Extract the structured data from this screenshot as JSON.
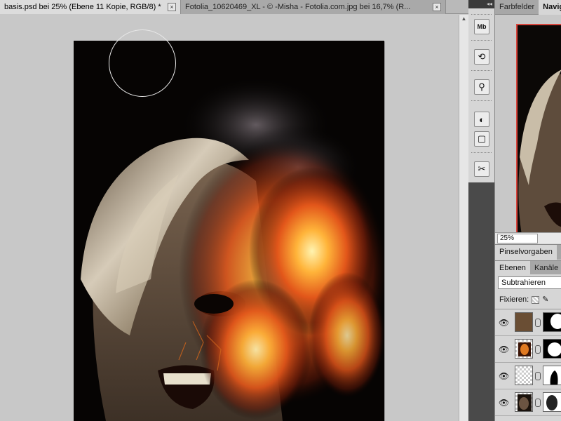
{
  "document_tabs": [
    {
      "label": "basis.psd bei 25% (Ebene 11 Kopie, RGB/8) *",
      "active": true,
      "close": "×"
    },
    {
      "label": "Fotolia_10620469_XL - © -Misha - Fotolia.com.jpg bei 16,7% (R...",
      "active": false,
      "close": "×"
    }
  ],
  "scrollbar": {
    "up_arrow": "▲"
  },
  "tool_strip": {
    "header": "◂◂",
    "tools": [
      {
        "name": "mini-bridge",
        "glyph": "Mb"
      },
      {
        "name": "history",
        "glyph": "⟲"
      },
      {
        "name": "clone-source",
        "glyph": "⚲"
      },
      {
        "name": "adjustments",
        "glyph": "◐"
      },
      {
        "name": "masks",
        "glyph": "▢"
      },
      {
        "name": "tool-presets",
        "glyph": "✂"
      }
    ]
  },
  "top_panel": {
    "tabs": [
      {
        "label": "Farbfelder",
        "active": false
      },
      {
        "label": "Navig",
        "active": true
      }
    ],
    "zoom_value": "25%"
  },
  "brush_panel": {
    "tabs": [
      {
        "label": "Pinselvorgaben",
        "active": true
      }
    ]
  },
  "layers_panel": {
    "tabs": [
      {
        "label": "Ebenen",
        "active": true
      },
      {
        "label": "Kanäle",
        "active": false
      }
    ],
    "blend_mode": "Subtrahieren",
    "lock_label": "Fixieren:",
    "visibility_glyph": "👁",
    "layers": [
      {
        "thumb": "texture",
        "visible": true
      },
      {
        "thumb": "fire",
        "visible": true
      },
      {
        "thumb": "transparent",
        "visible": true
      },
      {
        "thumb": "face",
        "visible": true
      }
    ]
  },
  "colors": {
    "accent_red": "#d8453c",
    "canvas_bg": "#c8c8c8",
    "panel_bg": "#d6d6d6"
  }
}
